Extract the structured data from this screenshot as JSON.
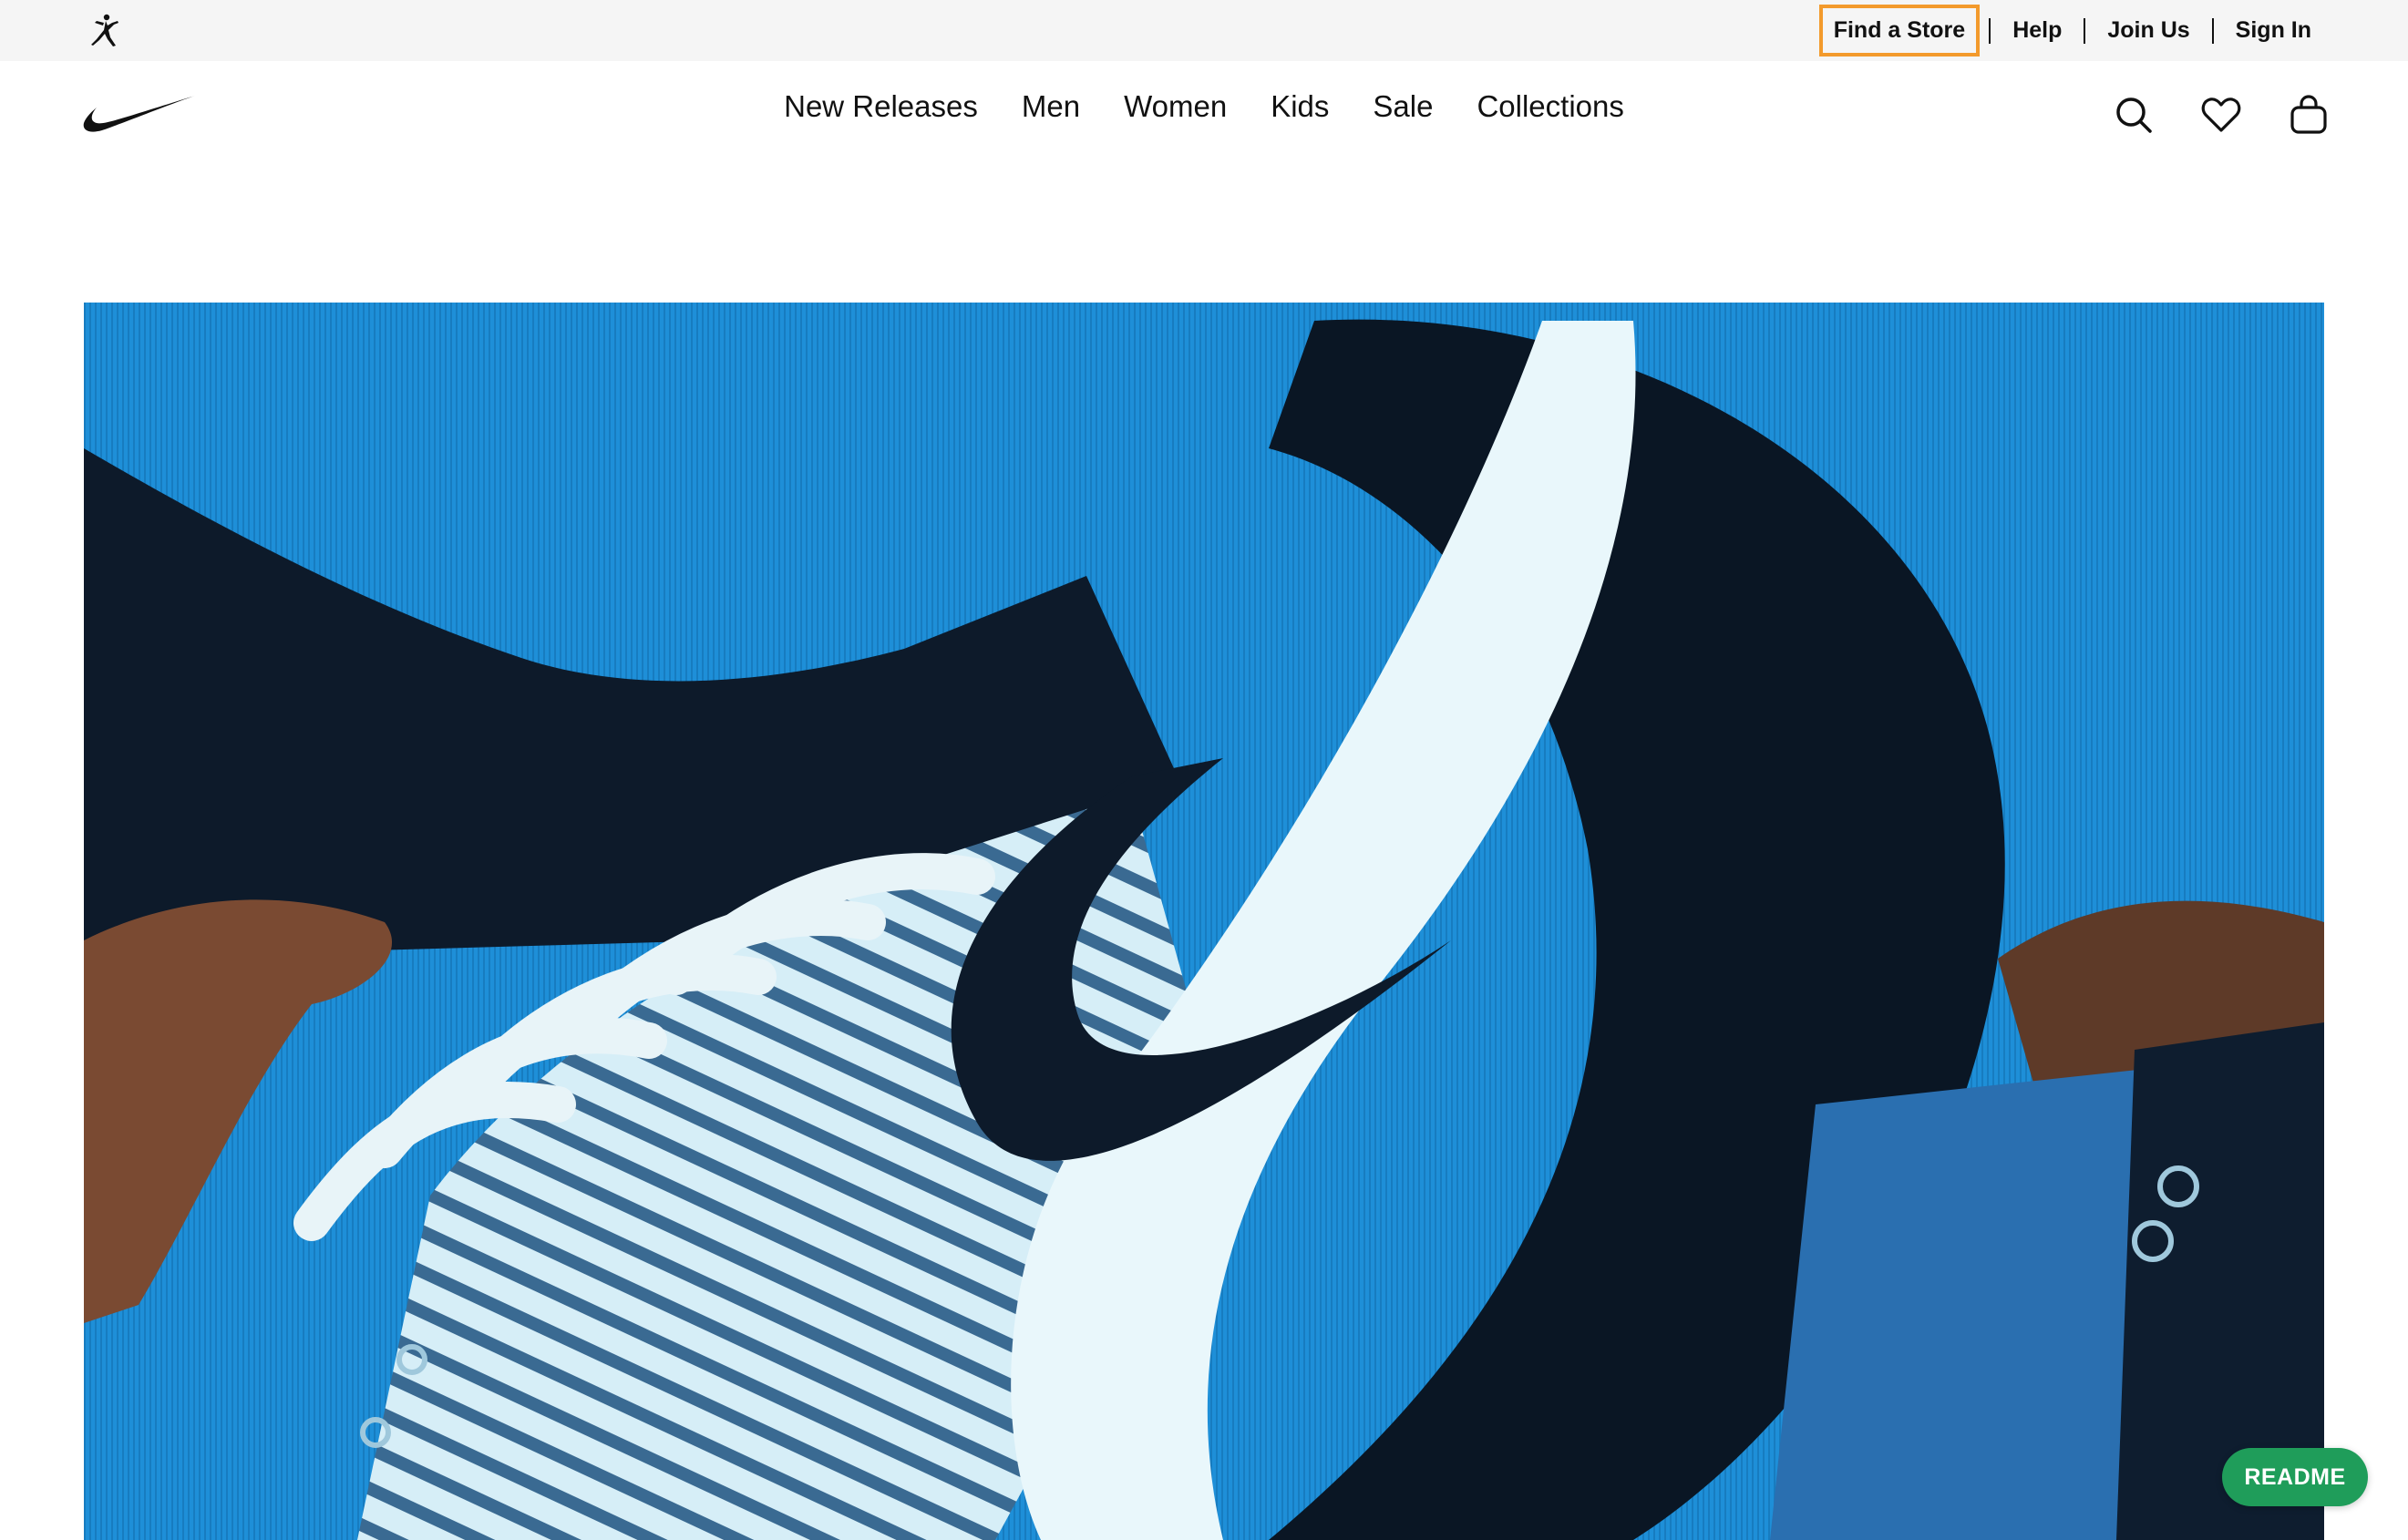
{
  "utility_bar": {
    "logo_icon": "jordan-jumpman-icon",
    "links": [
      {
        "label": "Find a Store",
        "focused": true
      },
      {
        "label": "Help"
      },
      {
        "label": "Join Us"
      },
      {
        "label": "Sign In"
      }
    ],
    "focus_color": "#f39a2c",
    "background": "#f5f5f5"
  },
  "main_nav": {
    "logo_icon": "nike-swoosh-icon",
    "menu": [
      {
        "label": "New Releases"
      },
      {
        "label": "Men"
      },
      {
        "label": "Women"
      },
      {
        "label": "Kids"
      },
      {
        "label": "Sale"
      },
      {
        "label": "Collections"
      }
    ],
    "icons": [
      "search-icon",
      "heart-icon",
      "bag-icon"
    ]
  },
  "hero": {
    "content": "close-up sneaker video frame on blue background",
    "accent": "#1f8fd6"
  },
  "readme_button": {
    "label": "README",
    "color": "#1f9d5a"
  }
}
